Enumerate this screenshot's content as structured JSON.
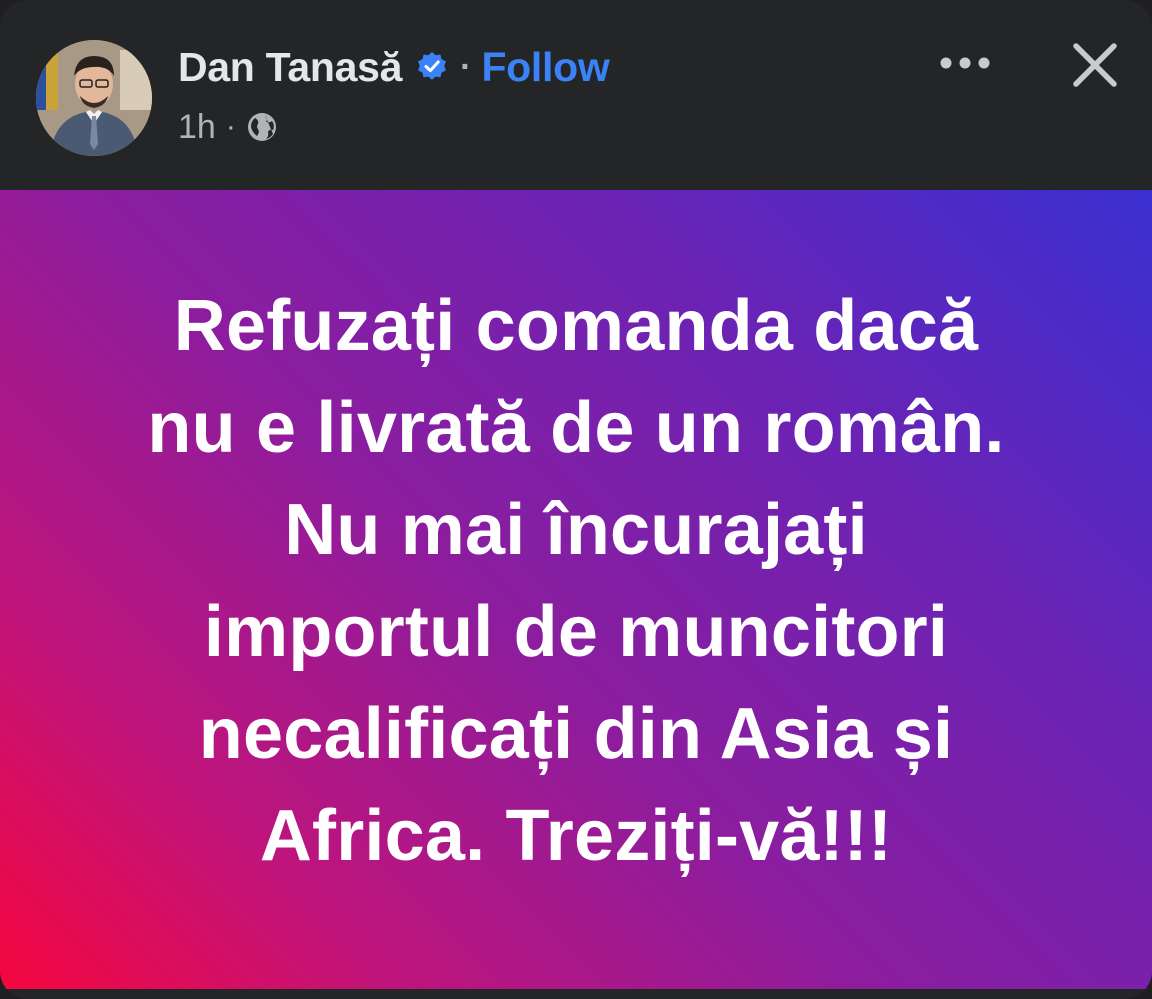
{
  "header": {
    "author_name": "Dan Tanasă",
    "separator": "·",
    "follow_label": "Follow",
    "timestamp": "1h",
    "meta_separator": "·",
    "icons": {
      "avatar": "profile-photo",
      "verified": "verified-badge-icon",
      "audience": "globe-icon",
      "more": "more-options-icon",
      "close": "close-icon"
    }
  },
  "post": {
    "lines": [
      "Refuzați comanda dacă",
      "nu e livrată de un român.",
      "Nu mai încurajați",
      "importul de muncitori",
      "necalificați din Asia și",
      "Africa. Treziți-vă!!!"
    ],
    "background_colors": [
      "#3a2fd0",
      "#8c1d9e",
      "#f5063f"
    ]
  },
  "colors": {
    "header_bg": "#242526",
    "name_text": "#e4e6eb",
    "follow_blue": "#3b82f6",
    "meta_text": "#b0b3b8"
  }
}
